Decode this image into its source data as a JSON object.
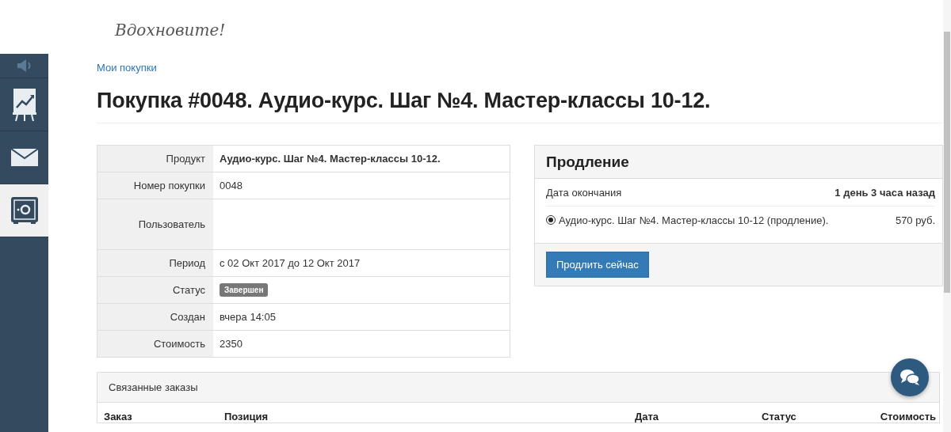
{
  "logo": {
    "text": "Вдохновите!"
  },
  "sidebar": {
    "items": [
      {
        "kind": "speaker",
        "selected": false
      },
      {
        "kind": "chart",
        "selected": false
      },
      {
        "kind": "mail",
        "selected": false
      },
      {
        "kind": "safe",
        "selected": true
      }
    ]
  },
  "breadcrumb": "Мои покупки",
  "title": "Покупка #0048. Аудио-курс. Шаг №4. Мастер-классы 10-12.",
  "details": [
    {
      "label": "Продукт",
      "value": "Аудио-курс. Шаг №4. Мастер-классы 10-12.",
      "kind": "bold"
    },
    {
      "label": "Номер покупки",
      "value": "0048",
      "kind": "text"
    },
    {
      "label": "Пользователь",
      "kind": "empty"
    },
    {
      "label": "Период",
      "value": "с 02 Окт 2017 до 12 Окт 2017",
      "kind": "text"
    },
    {
      "label": "Статус",
      "value": "Завершен",
      "kind": "badge"
    },
    {
      "label": "Создан",
      "value": "вчера 14:05",
      "kind": "text"
    },
    {
      "label": "Стоимость",
      "value": "2350",
      "kind": "text"
    }
  ],
  "renewal": {
    "title": "Продление",
    "end_label": "Дата окончания",
    "end_value": "1 день 3 часа назад",
    "options": [
      {
        "label": "Аудио-курс. Шаг №4. Мастер-классы 10-12 (продление).",
        "price": "570 руб.",
        "selected": true
      }
    ],
    "button": "Продлить сейчас"
  },
  "related_orders": {
    "title": "Связанные заказы",
    "columns": [
      "Заказ",
      "Позиция",
      "Дата",
      "Статус",
      "Стоимость"
    ]
  }
}
